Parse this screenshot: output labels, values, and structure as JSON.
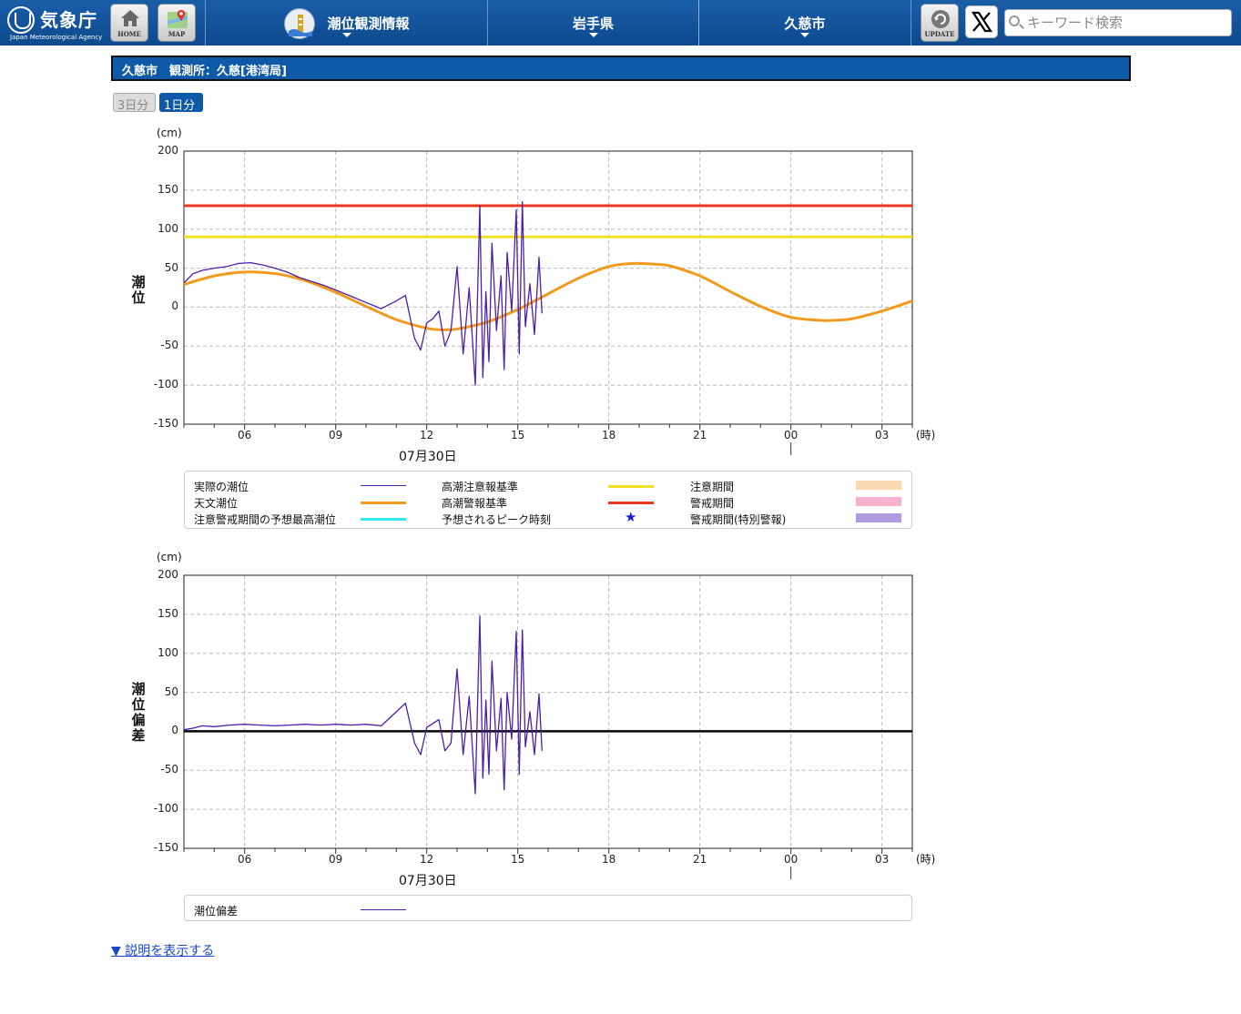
{
  "header": {
    "logo_ja": "気象庁",
    "logo_en": "Japan Meteorological Agency",
    "home_label": "HOME",
    "map_label": "MAP",
    "nav": [
      {
        "label": "潮位観測情報",
        "icon": "tide-gauge-icon"
      },
      {
        "label": "岩手県"
      },
      {
        "label": "久慈市"
      }
    ],
    "update_label": "UPDATE",
    "x_icon": "x-logo-icon",
    "search_placeholder": "キーワード検索",
    "accent": "#0f5aa8"
  },
  "station": {
    "title": "久慈市　観測所：久慈[港湾局]"
  },
  "range_buttons": {
    "three_days": "3日分",
    "one_day": "1日分",
    "selected": "1日分"
  },
  "chart1": {
    "unit": "(cm)",
    "ylabel": "潮位",
    "yticks": [
      "200",
      "150",
      "100",
      "50",
      "0",
      "-50",
      "-100",
      "-150"
    ],
    "xticks": [
      "06",
      "09",
      "12",
      "15",
      "18",
      "21",
      "00",
      "03"
    ],
    "hour_unit": "(時)",
    "date_label": "07月30日"
  },
  "chart2": {
    "unit": "(cm)",
    "ylabel": "潮位偏差",
    "yticks": [
      "200",
      "150",
      "100",
      "50",
      "0",
      "-50",
      "-100",
      "-150"
    ],
    "xticks": [
      "06",
      "09",
      "12",
      "15",
      "18",
      "21",
      "00",
      "03"
    ],
    "hour_unit": "(時)",
    "date_label": "07月30日"
  },
  "legend1": [
    {
      "label": "実際の潮位",
      "swatch": "line",
      "color": "#4b1fa8"
    },
    {
      "label": "高潮注意報基準",
      "swatch": "line",
      "color": "#f0e024"
    },
    {
      "label": "注意期間",
      "swatch": "box",
      "color": "#fbd9b0"
    },
    {
      "label": "天文潮位",
      "swatch": "line",
      "color": "#f29a1d"
    },
    {
      "label": "高潮警報基準",
      "swatch": "line",
      "color": "#e8381f"
    },
    {
      "label": "警戒期間",
      "swatch": "box",
      "color": "#f7b3cd"
    },
    {
      "label": "注意警戒期間の予想最高潮位",
      "swatch": "line",
      "color": "#33e8f0"
    },
    {
      "label": "予想されるピーク時刻",
      "swatch": "star",
      "color": "#1020d0"
    },
    {
      "label": "警戒期間(特別警報)",
      "swatch": "box",
      "color": "#b09ae0"
    }
  ],
  "legend2": [
    {
      "label": "潮位偏差",
      "swatch": "line",
      "color": "#4b1fa8"
    }
  ],
  "explain_link": "▼ 説明を表示する",
  "chart_data": [
    {
      "type": "line",
      "ylabel": "潮位",
      "yunit": "cm",
      "ylim": [
        -150,
        200
      ],
      "xlim_hours": [
        4,
        28
      ],
      "x_tick_labels": [
        "06",
        "09",
        "12",
        "15",
        "18",
        "21",
        "00",
        "03"
      ],
      "date_label": "07月30日",
      "grid": true,
      "thresholds": [
        {
          "name": "高潮警報基準",
          "value": 130,
          "color": "#e8381f"
        },
        {
          "name": "高潮注意報基準",
          "value": 90,
          "color": "#f0e024"
        }
      ],
      "series": [
        {
          "name": "天文潮位",
          "color": "#f29a1d",
          "x": [
            4.0,
            5.0,
            6.0,
            7.0,
            8.0,
            9.0,
            10.0,
            11.0,
            12.0,
            12.5,
            13.0,
            14.0,
            15.0,
            16.0,
            17.0,
            18.0,
            18.8,
            19.5,
            20.0,
            21.0,
            22.0,
            23.0,
            24.0,
            25.0,
            25.3,
            26.0,
            27.0,
            28.0
          ],
          "y": [
            29,
            40,
            45,
            43,
            34,
            19,
            1,
            -16,
            -27,
            -29,
            -28,
            -19,
            -3,
            17,
            37,
            52,
            56,
            55,
            53,
            40,
            20,
            1,
            -13,
            -17,
            -17,
            -15,
            -5,
            8
          ]
        },
        {
          "name": "実際の潮位",
          "color": "#4b1fa8",
          "x": [
            4.0,
            4.3,
            4.6,
            5.0,
            5.4,
            5.8,
            6.2,
            6.6,
            7.0,
            7.4,
            7.8,
            8.2,
            8.6,
            9.0,
            9.5,
            10.0,
            10.5,
            11.0,
            11.3,
            11.6,
            11.8,
            12.0,
            12.2,
            12.4,
            12.6,
            12.8,
            13.0,
            13.2,
            13.4,
            13.6,
            13.75,
            13.85,
            13.95,
            14.05,
            14.15,
            14.3,
            14.45,
            14.55,
            14.65,
            14.8,
            14.95,
            15.05,
            15.15,
            15.25,
            15.4,
            15.55,
            15.7,
            15.8
          ],
          "y": [
            31,
            43,
            47,
            50,
            52,
            56,
            57,
            54,
            50,
            45,
            38,
            33,
            28,
            22,
            14,
            6,
            -2,
            8,
            15,
            -40,
            -55,
            -20,
            -15,
            -5,
            -50,
            -30,
            52,
            -60,
            25,
            -100,
            130,
            -90,
            20,
            -70,
            82,
            -30,
            40,
            -80,
            70,
            -5,
            125,
            -60,
            135,
            -25,
            30,
            -35,
            64,
            -8
          ]
        }
      ]
    },
    {
      "type": "line",
      "ylabel": "潮位偏差",
      "yunit": "cm",
      "ylim": [
        -150,
        200
      ],
      "xlim_hours": [
        4,
        28
      ],
      "x_tick_labels": [
        "06",
        "09",
        "12",
        "15",
        "18",
        "21",
        "00",
        "03"
      ],
      "date_label": "07月30日",
      "grid": true,
      "baseline": 0,
      "series": [
        {
          "name": "潮位偏差",
          "color": "#4b1fa8",
          "x": [
            4.0,
            4.3,
            4.6,
            5.0,
            5.5,
            6.0,
            6.5,
            7.0,
            7.5,
            8.0,
            8.5,
            9.0,
            9.5,
            10.0,
            10.5,
            11.0,
            11.3,
            11.6,
            11.8,
            12.0,
            12.2,
            12.4,
            12.6,
            12.8,
            13.0,
            13.2,
            13.4,
            13.6,
            13.75,
            13.85,
            13.95,
            14.05,
            14.15,
            14.3,
            14.45,
            14.55,
            14.65,
            14.8,
            14.95,
            15.05,
            15.15,
            15.25,
            15.4,
            15.55,
            15.7,
            15.8
          ],
          "y": [
            2,
            4,
            7,
            6,
            8,
            9,
            8,
            7,
            8,
            9,
            8,
            9,
            8,
            9,
            7,
            25,
            36,
            -15,
            -30,
            5,
            10,
            15,
            -25,
            -15,
            80,
            -30,
            45,
            -80,
            148,
            -60,
            40,
            -55,
            90,
            -25,
            42,
            -75,
            50,
            -10,
            128,
            -55,
            130,
            -20,
            25,
            -30,
            48,
            -25
          ]
        }
      ]
    }
  ]
}
